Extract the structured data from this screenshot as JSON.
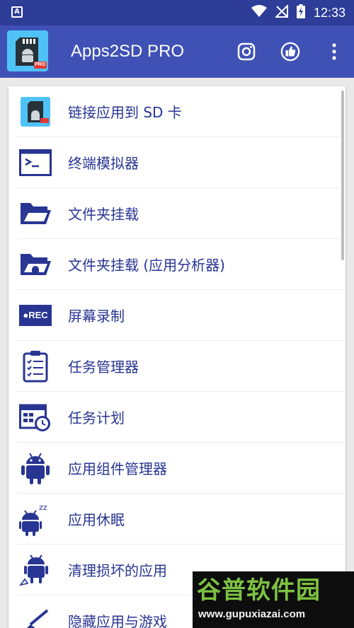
{
  "status_bar": {
    "left_badge": "A",
    "time": "12:33"
  },
  "app_bar": {
    "title": "Apps2SD PRO",
    "logo_badge": "PRO",
    "actions": [
      "instagram-icon",
      "thumbs-up-icon",
      "overflow-menu-icon"
    ]
  },
  "menu": {
    "items": [
      {
        "label": "链接应用到 SD 卡",
        "icon": "sd-card-link-icon"
      },
      {
        "label": "终端模拟器",
        "icon": "terminal-icon"
      },
      {
        "label": "文件夹挂载",
        "icon": "folder-icon"
      },
      {
        "label": "文件夹挂载 (应用分析器)",
        "icon": "folder-android-icon"
      },
      {
        "label": "屏幕录制",
        "icon": "screen-record-icon"
      },
      {
        "label": "任务管理器",
        "icon": "clipboard-checklist-icon"
      },
      {
        "label": "任务计划",
        "icon": "calendar-clock-icon"
      },
      {
        "label": "应用组件管理器",
        "icon": "android-icon"
      },
      {
        "label": "应用休眠",
        "icon": "android-sleep-icon"
      },
      {
        "label": "清理损坏的应用",
        "icon": "android-broom-icon"
      },
      {
        "label": "隐藏应用与游戏",
        "icon": "hide-pen-icon"
      }
    ]
  },
  "screen_record_badge": "●REC",
  "watermark": {
    "title": "谷普软件园",
    "url": "www.gupuxiazai.com"
  },
  "colors": {
    "status_bar": "#2e3d98",
    "app_bar": "#3f51b5",
    "label_text": "#283593",
    "icon_primary": "#303f9f",
    "watermark_green": "#7cc242"
  }
}
